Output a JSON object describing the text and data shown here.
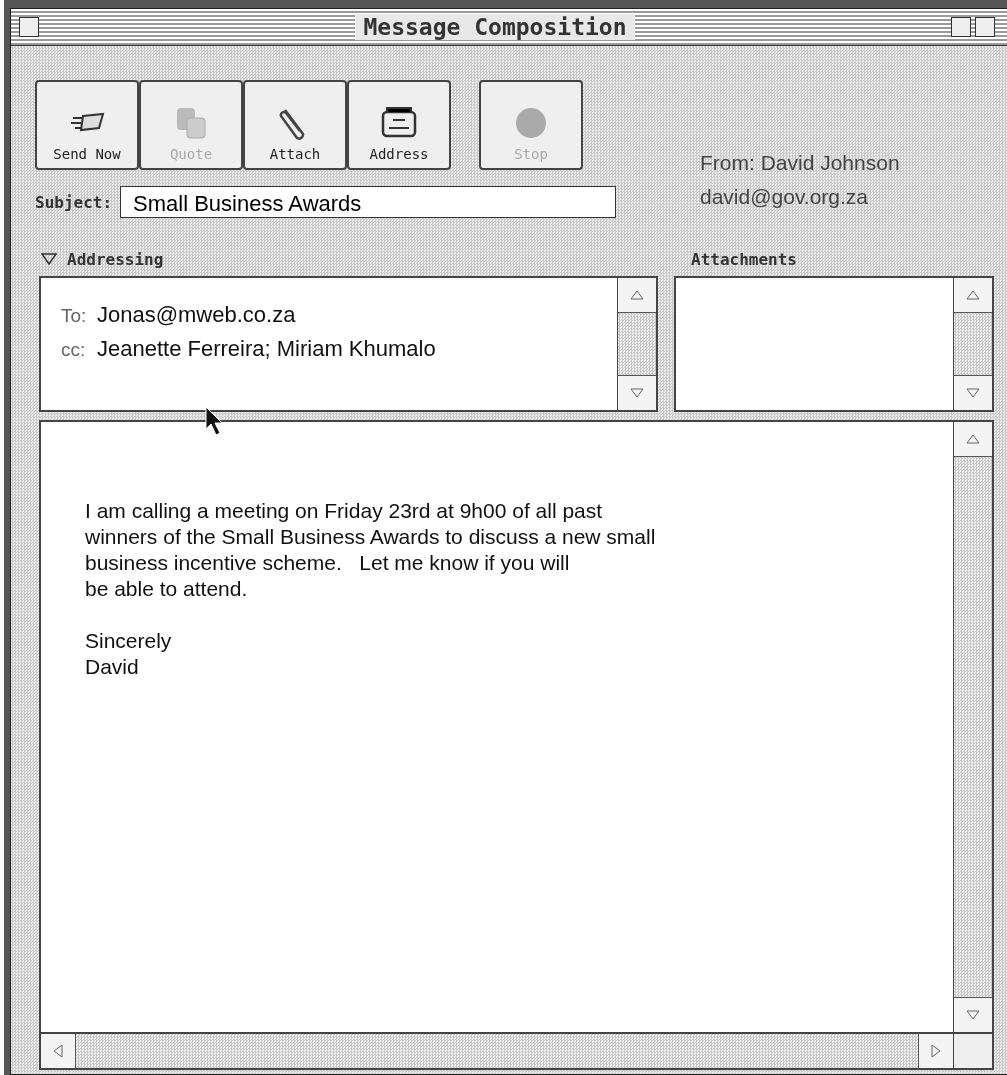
{
  "window": {
    "title": "Message Composition"
  },
  "toolbar": [
    {
      "kind": "send",
      "label": "Send Now",
      "disabled": false
    },
    {
      "kind": "quote",
      "label": "Quote",
      "disabled": true
    },
    {
      "kind": "attach",
      "label": "Attach",
      "disabled": false
    },
    {
      "kind": "address",
      "label": "Address",
      "disabled": false
    },
    {
      "kind": "stop",
      "label": "Stop",
      "disabled": true
    }
  ],
  "sender": {
    "name_line": "From: David Johnson",
    "email": "david@gov.org.za"
  },
  "subject": {
    "label": "Subject:",
    "value": "Small Business Awards"
  },
  "addressing": {
    "label": "Addressing",
    "expanded": true,
    "fields": [
      {
        "label": "To:",
        "value": "Jonas@mweb.co.za"
      },
      {
        "label": "cc:",
        "value": "Jeanette Ferreira; Miriam Khumalo"
      }
    ]
  },
  "attachments": {
    "label": "Attachments"
  },
  "body": {
    "paragraphs": [
      [
        "I am calling a meeting on Friday 23rd at 9h00 of all past",
        "winners of the Small Business Awards to discuss a new small",
        "business incentive scheme.   Let me know if you will",
        "be able to attend."
      ],
      [
        "Sincerely",
        "David"
      ]
    ]
  }
}
